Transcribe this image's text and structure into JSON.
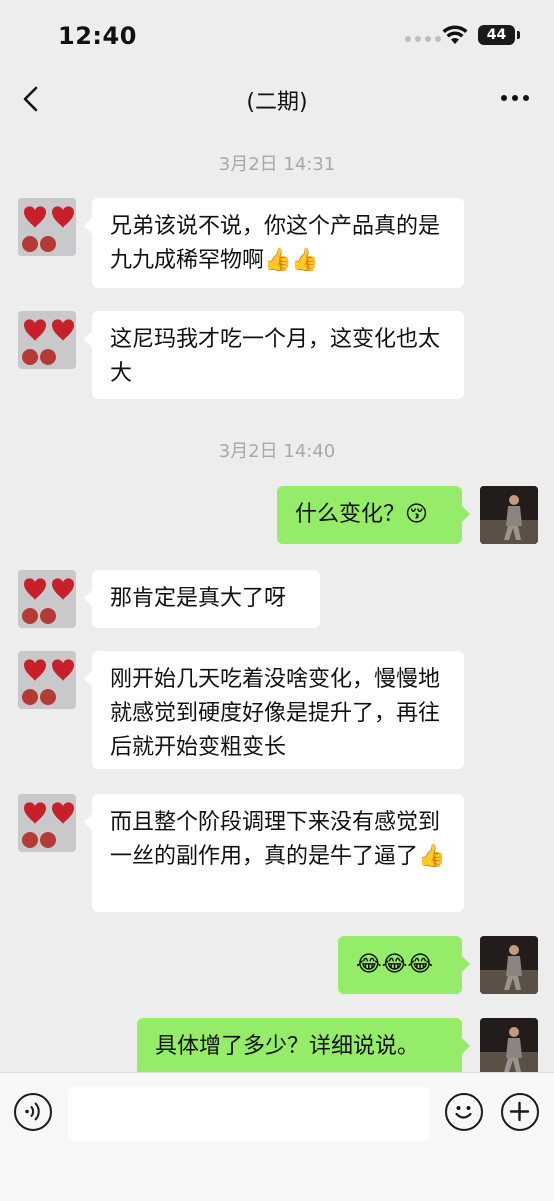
{
  "status_bar": {
    "time": "12:40",
    "battery": "44"
  },
  "header": {
    "title": "(二期)"
  },
  "messages": [
    {
      "type": "timestamp",
      "text": "3月2日 14:31"
    },
    {
      "type": "incoming",
      "text": "兄弟该说不说，你这个产品真的是九九成稀罕物啊",
      "emoji": "👍👍"
    },
    {
      "type": "incoming",
      "text": "这尼玛我才吃一个月，这变化也太大",
      "emoji": ""
    },
    {
      "type": "timestamp",
      "text": "3月2日 14:40"
    },
    {
      "type": "outgoing",
      "text": "什么变化？",
      "emoji": "😚"
    },
    {
      "type": "incoming",
      "text": "那肯定是真大了呀",
      "emoji": ""
    },
    {
      "type": "incoming",
      "text": "刚开始几天吃着没啥变化，慢慢地就感觉到硬度好像是提升了，再往后就开始变粗变长",
      "emoji": ""
    },
    {
      "type": "incoming",
      "text": "而且整个阶段调理下来没有感觉到一丝的副作用，真的是牛了逼了",
      "emoji": "👍"
    },
    {
      "type": "outgoing",
      "text": "",
      "emoji": "😂😂😂"
    },
    {
      "type": "outgoing",
      "text": "具体增了多少？详细说说。",
      "emoji": ""
    }
  ],
  "input_bar": {
    "value": "",
    "placeholder": ""
  },
  "icons": [
    "back-arrow-icon",
    "more-dots-icon",
    "voice-icon",
    "emoji-face-icon",
    "plus-icon",
    "wifi-icon"
  ],
  "colors": {
    "background": "#ededed",
    "incoming_bubble": "#ffffff",
    "outgoing_bubble": "#95ec69"
  }
}
